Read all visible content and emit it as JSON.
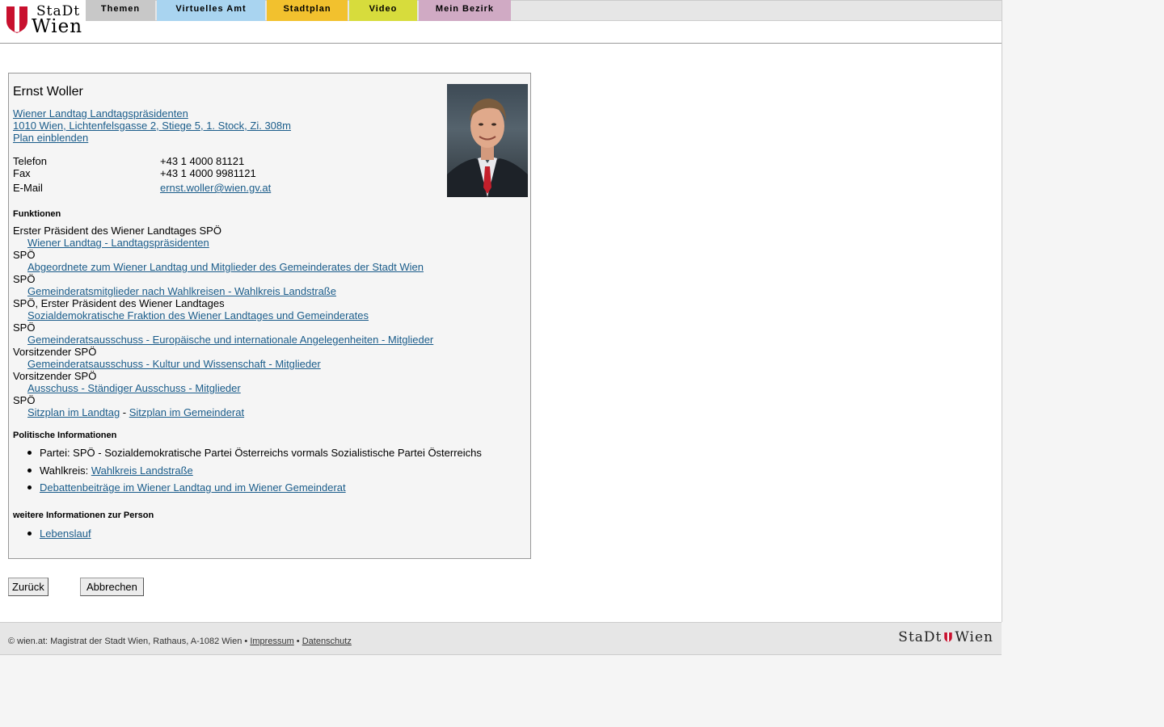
{
  "header": {
    "logo_top": "StaDt",
    "logo_bottom": "Wien",
    "tabs": [
      {
        "label": "Themen",
        "color": "#c8c8c8",
        "width": 86
      },
      {
        "label": "Virtuelles Amt",
        "color": "#a9d4f0",
        "width": 134
      },
      {
        "label": "Stadtplan",
        "color": "#f2c12e",
        "width": 100
      },
      {
        "label": "Video",
        "color": "#d7dc3c",
        "width": 84
      },
      {
        "label": "Mein Bezirk",
        "color": "#d0aac4",
        "width": 114
      }
    ]
  },
  "person": {
    "name": "Ernst Woller",
    "org_link": "Wiener Landtag Landtagspräsidenten",
    "address_link": "1010 Wien, Lichtenfelsgasse 2, Stiege 5, 1. Stock, Zi. 308m",
    "plan_link": "Plan einblenden",
    "contact": {
      "phone_label": "Telefon",
      "phone": "+43 1 4000 81121",
      "fax_label": "Fax",
      "fax": "+43 1 4000 9981121",
      "email_label": "E-Mail",
      "email": "ernst.woller@wien.gv.at"
    }
  },
  "functions": {
    "heading": "Funktionen",
    "items": [
      {
        "role": "Erster Präsident des Wiener Landtages SPÖ",
        "link": "Wiener Landtag - Landtagspräsidenten"
      },
      {
        "role": "SPÖ",
        "link": "Abgeordnete zum Wiener Landtag und Mitglieder des Gemeinderates der Stadt Wien"
      },
      {
        "role": "SPÖ",
        "link": "Gemeinderatsmitglieder nach Wahlkreisen - Wahlkreis Landstraße"
      },
      {
        "role": "SPÖ, Erster Präsident des Wiener Landtages",
        "link": "Sozialdemokratische Fraktion des Wiener Landtages und Gemeinderates"
      },
      {
        "role": "SPÖ",
        "link": "Gemeinderatsausschuss - Europäische und internationale Angelegenheiten - Mitglieder"
      },
      {
        "role": "Vorsitzender SPÖ",
        "link": "Gemeinderatsausschuss - Kultur und Wissenschaft - Mitglieder"
      },
      {
        "role": "Vorsitzender SPÖ",
        "link": "Ausschuss - Ständiger Ausschuss - Mitglieder"
      }
    ],
    "last_role": "SPÖ",
    "seat_link_1": "Sitzplan im Landtag",
    "seat_sep": " - ",
    "seat_link_2": "Sitzplan im Gemeinderat"
  },
  "political": {
    "heading": "Politische Informationen",
    "party": "Partei: SPÖ - Sozialdemokratische Partei Österreichs vormals Sozialistische Partei Österreichs",
    "wahlkreis_label": "Wahlkreis: ",
    "wahlkreis_link": "Wahlkreis Landstraße",
    "debate_link": "Debattenbeiträge im Wiener Landtag und im Wiener Gemeinderat"
  },
  "more": {
    "heading": "weitere Informationen zur Person",
    "cv_link": "Lebenslauf"
  },
  "buttons": {
    "back": "Zurück",
    "cancel": "Abbrechen"
  },
  "footer": {
    "copyright": "© wien.at: Magistrat der Stadt Wien, Rathaus, A-1082 Wien • ",
    "impressum": "Impressum",
    "sep": " • ",
    "datenschutz": "Datenschutz",
    "logo_left": "StaDt",
    "logo_right": "Wien"
  }
}
